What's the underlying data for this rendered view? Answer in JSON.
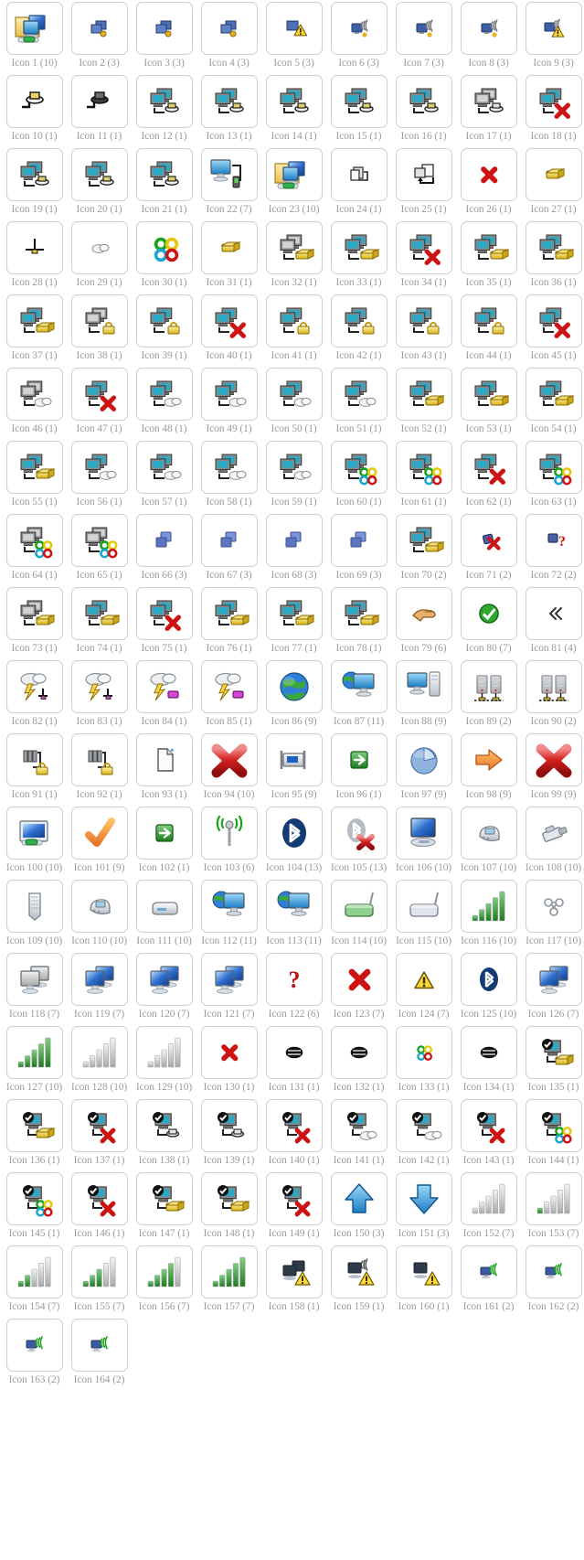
{
  "page": {
    "title": "Icon Sheet",
    "columns": 9,
    "total_icons": 164,
    "label_color": "#9b9b9b",
    "tile_border_color": "#cfcfcf",
    "background_color": "#ffffff"
  },
  "icons": [
    {
      "label": "Icon 1 (10)",
      "name": "folder-computers-cable",
      "glyph": "folder-pc"
    },
    {
      "label": "Icon 2 (3)",
      "name": "network-small-dot",
      "glyph": "mini-screens-dot"
    },
    {
      "label": "Icon 3 (3)",
      "name": "network-small-dot",
      "glyph": "mini-screens-dot"
    },
    {
      "label": "Icon 4 (3)",
      "name": "network-small-dot",
      "glyph": "mini-screens-dot"
    },
    {
      "label": "Icon 5 (3)",
      "name": "network-small-warning",
      "glyph": "mini-screens-warn"
    },
    {
      "label": "Icon 6 (3)",
      "name": "wireless-signal-small",
      "glyph": "mini-wireless"
    },
    {
      "label": "Icon 7 (3)",
      "name": "wireless-signal-small",
      "glyph": "mini-wireless"
    },
    {
      "label": "Icon 8 (3)",
      "name": "wireless-signal-dot",
      "glyph": "mini-wireless"
    },
    {
      "label": "Icon 9 (3)",
      "name": "wireless-warning",
      "glyph": "mini-wireless-warn"
    },
    {
      "label": "Icon 10 (1)",
      "name": "plug-connector",
      "glyph": "plug"
    },
    {
      "label": "Icon 11 (1)",
      "name": "plug-connector-dark",
      "glyph": "plug-dark"
    },
    {
      "label": "Icon 12 (1)",
      "name": "computer-to-plug",
      "glyph": "pc-plug"
    },
    {
      "label": "Icon 13 (1)",
      "name": "computer-to-plug",
      "glyph": "pc-plug"
    },
    {
      "label": "Icon 14 (1)",
      "name": "computer-to-plug",
      "glyph": "pc-plug"
    },
    {
      "label": "Icon 15 (1)",
      "name": "computer-to-plug",
      "glyph": "pc-plug"
    },
    {
      "label": "Icon 16 (1)",
      "name": "computer-to-plug",
      "glyph": "pc-plug"
    },
    {
      "label": "Icon 17 (1)",
      "name": "computer-grey-to-plug",
      "glyph": "pc-plug-grey"
    },
    {
      "label": "Icon 18 (1)",
      "name": "computer-disconnected",
      "glyph": "pc-error"
    },
    {
      "label": "Icon 19 (1)",
      "name": "computer-to-plug",
      "glyph": "pc-plug"
    },
    {
      "label": "Icon 20 (1)",
      "name": "computer-to-plug",
      "glyph": "pc-plug"
    },
    {
      "label": "Icon 21 (1)",
      "name": "computer-to-plug",
      "glyph": "pc-plug"
    },
    {
      "label": "Icon 22 (7)",
      "name": "monitor-with-device",
      "glyph": "monitor-device"
    },
    {
      "label": "Icon 23 (10)",
      "name": "folder-computers-cable",
      "glyph": "folder-pc"
    },
    {
      "label": "Icon 24 (1)",
      "name": "copy-small",
      "glyph": "copy"
    },
    {
      "label": "Icon 25 (1)",
      "name": "copy-arrow",
      "glyph": "copy-arrow"
    },
    {
      "label": "Icon 26 (1)",
      "name": "red-x-small",
      "glyph": "x-red-small"
    },
    {
      "label": "Icon 27 (1)",
      "name": "gold-connector",
      "glyph": "gold"
    },
    {
      "label": "Icon 28 (1)",
      "name": "ground-symbol",
      "glyph": "ground"
    },
    {
      "label": "Icon 29 (1)",
      "name": "cloud-small",
      "glyph": "cloud-sm"
    },
    {
      "label": "Icon 30 (1)",
      "name": "colored-loops",
      "glyph": "loops"
    },
    {
      "label": "Icon 31 (1)",
      "name": "gold-connector",
      "glyph": "gold"
    },
    {
      "label": "Icon 32 (1)",
      "name": "computer-grey-gold",
      "glyph": "pc-gold-grey"
    },
    {
      "label": "Icon 33 (1)",
      "name": "computer-gold",
      "glyph": "pc-gold"
    },
    {
      "label": "Icon 34 (1)",
      "name": "computer-gold-error",
      "glyph": "pc-error"
    },
    {
      "label": "Icon 35 (1)",
      "name": "computer-gold",
      "glyph": "pc-gold"
    },
    {
      "label": "Icon 36 (1)",
      "name": "computer-gold",
      "glyph": "pc-gold"
    },
    {
      "label": "Icon 37 (1)",
      "name": "computer-gold",
      "glyph": "pc-gold"
    },
    {
      "label": "Icon 38 (1)",
      "name": "computer-grey-lock",
      "glyph": "pc-lock-grey"
    },
    {
      "label": "Icon 39 (1)",
      "name": "computer-lock",
      "glyph": "pc-lock"
    },
    {
      "label": "Icon 40 (1)",
      "name": "computer-lock-error",
      "glyph": "pc-error"
    },
    {
      "label": "Icon 41 (1)",
      "name": "computer-lock",
      "glyph": "pc-lock"
    },
    {
      "label": "Icon 42 (1)",
      "name": "computer-lock",
      "glyph": "pc-lock"
    },
    {
      "label": "Icon 43 (1)",
      "name": "computer-lock",
      "glyph": "pc-lock"
    },
    {
      "label": "Icon 44 (1)",
      "name": "computer-lock",
      "glyph": "pc-lock"
    },
    {
      "label": "Icon 45 (1)",
      "name": "computer-lock-error",
      "glyph": "pc-error"
    },
    {
      "label": "Icon 46 (1)",
      "name": "computer-grey-cloud",
      "glyph": "pc-cloud-grey"
    },
    {
      "label": "Icon 47 (1)",
      "name": "computer-cloud-error",
      "glyph": "pc-error"
    },
    {
      "label": "Icon 48 (1)",
      "name": "computer-cloud",
      "glyph": "pc-cloud"
    },
    {
      "label": "Icon 49 (1)",
      "name": "computer-cloud",
      "glyph": "pc-cloud"
    },
    {
      "label": "Icon 50 (1)",
      "name": "computer-cloud",
      "glyph": "pc-cloud"
    },
    {
      "label": "Icon 51 (1)",
      "name": "computer-cloud",
      "glyph": "pc-cloud"
    },
    {
      "label": "Icon 52 (1)",
      "name": "computer-gold-up",
      "glyph": "pc-gold"
    },
    {
      "label": "Icon 53 (1)",
      "name": "computer-gold-up",
      "glyph": "pc-gold"
    },
    {
      "label": "Icon 54 (1)",
      "name": "computer-gold-up",
      "glyph": "pc-gold"
    },
    {
      "label": "Icon 55 (1)",
      "name": "computer-gold-up",
      "glyph": "pc-gold"
    },
    {
      "label": "Icon 56 (1)",
      "name": "computer-cloud-up",
      "glyph": "pc-cloud"
    },
    {
      "label": "Icon 57 (1)",
      "name": "computer-cloud-up",
      "glyph": "pc-cloud"
    },
    {
      "label": "Icon 58 (1)",
      "name": "computer-cloud-up",
      "glyph": "pc-cloud"
    },
    {
      "label": "Icon 59 (1)",
      "name": "computer-cloud-up",
      "glyph": "pc-cloud"
    },
    {
      "label": "Icon 60 (1)",
      "name": "computer-loops",
      "glyph": "pc-loops"
    },
    {
      "label": "Icon 61 (1)",
      "name": "computer-loops",
      "glyph": "pc-loops"
    },
    {
      "label": "Icon 62 (1)",
      "name": "computer-loops-error",
      "glyph": "pc-error"
    },
    {
      "label": "Icon 63 (1)",
      "name": "computer-loops",
      "glyph": "pc-loops"
    },
    {
      "label": "Icon 64 (1)",
      "name": "computer-grey-loops",
      "glyph": "pc-loops-grey"
    },
    {
      "label": "Icon 65 (1)",
      "name": "computer-grey-loops",
      "glyph": "pc-loops-grey"
    },
    {
      "label": "Icon 66 (3)",
      "name": "network-blue-small",
      "glyph": "mini-screens-blue"
    },
    {
      "label": "Icon 67 (3)",
      "name": "network-blue-small",
      "glyph": "mini-screens-blue"
    },
    {
      "label": "Icon 68 (3)",
      "name": "network-blue-small",
      "glyph": "mini-screens-blue"
    },
    {
      "label": "Icon 69 (3)",
      "name": "network-blue-small",
      "glyph": "mini-screens-blue"
    },
    {
      "label": "Icon 70 (2)",
      "name": "computer-gold-wave",
      "glyph": "pc-gold"
    },
    {
      "label": "Icon 71 (2)",
      "name": "network-red-x",
      "glyph": "net-x"
    },
    {
      "label": "Icon 72 (2)",
      "name": "network-question",
      "glyph": "net-question"
    },
    {
      "label": "Icon 73 (1)",
      "name": "computer-grey-gold",
      "glyph": "pc-gold-grey"
    },
    {
      "label": "Icon 74 (1)",
      "name": "computer-gold",
      "glyph": "pc-gold"
    },
    {
      "label": "Icon 75 (1)",
      "name": "computer-gold-error",
      "glyph": "pc-error"
    },
    {
      "label": "Icon 76 (1)",
      "name": "computer-gold",
      "glyph": "pc-gold"
    },
    {
      "label": "Icon 77 (1)",
      "name": "computer-gold",
      "glyph": "pc-gold"
    },
    {
      "label": "Icon 78 (1)",
      "name": "computer-gold",
      "glyph": "pc-gold"
    },
    {
      "label": "Icon 79 (6)",
      "name": "pointing-hand",
      "glyph": "hand"
    },
    {
      "label": "Icon 80 (7)",
      "name": "green-check-shield",
      "glyph": "check-green"
    },
    {
      "label": "Icon 81 (4)",
      "name": "double-chevron-left",
      "glyph": "chevrons"
    },
    {
      "label": "Icon 82 (1)",
      "name": "storm-cloud-ground",
      "glyph": "storm-ground"
    },
    {
      "label": "Icon 83 (1)",
      "name": "storm-cloud-ground",
      "glyph": "storm-ground"
    },
    {
      "label": "Icon 84 (1)",
      "name": "storm-cloud-device",
      "glyph": "storm-device"
    },
    {
      "label": "Icon 85 (1)",
      "name": "storm-cloud-device",
      "glyph": "storm-device"
    },
    {
      "label": "Icon 86 (9)",
      "name": "globe",
      "glyph": "globe"
    },
    {
      "label": "Icon 87 (11)",
      "name": "globe-monitor",
      "glyph": "globe-monitor"
    },
    {
      "label": "Icon 88 (9)",
      "name": "desktop-tower",
      "glyph": "desktop-tower"
    },
    {
      "label": "Icon 89 (2)",
      "name": "server-pair",
      "glyph": "servers"
    },
    {
      "label": "Icon 90 (2)",
      "name": "server-pair",
      "glyph": "servers"
    },
    {
      "label": "Icon 91 (1)",
      "name": "ports-to-plug",
      "glyph": "ports-plug"
    },
    {
      "label": "Icon 92 (1)",
      "name": "ports-to-plug",
      "glyph": "ports-plug"
    },
    {
      "label": "Icon 93 (1)",
      "name": "page-new",
      "glyph": "page"
    },
    {
      "label": "Icon 94 (10)",
      "name": "red-x-large",
      "glyph": "x-red-big"
    },
    {
      "label": "Icon 95 (9)",
      "name": "network-adapter",
      "glyph": "adapter"
    },
    {
      "label": "Icon 96 (1)",
      "name": "green-arrow-box",
      "glyph": "arrow-green-box"
    },
    {
      "label": "Icon 97 (9)",
      "name": "pie-chart",
      "glyph": "pie"
    },
    {
      "label": "Icon 98 (9)",
      "name": "orange-arrow-right",
      "glyph": "arrow-orange"
    },
    {
      "label": "Icon 99 (9)",
      "name": "red-x-large",
      "glyph": "x-red-big"
    },
    {
      "label": "Icon 100 (10)",
      "name": "monitor-cable",
      "glyph": "monitor-cable"
    },
    {
      "label": "Icon 101 (9)",
      "name": "orange-checkmark",
      "glyph": "check-orange"
    },
    {
      "label": "Icon 102 (1)",
      "name": "green-arrow-box",
      "glyph": "arrow-green-box"
    },
    {
      "label": "Icon 103 (6)",
      "name": "wireless-antenna",
      "glyph": "antenna"
    },
    {
      "label": "Icon 104 (13)",
      "name": "bluetooth-logo",
      "glyph": "bluetooth"
    },
    {
      "label": "Icon 105 (13)",
      "name": "bluetooth-disabled",
      "glyph": "bluetooth-off"
    },
    {
      "label": "Icon 106 (10)",
      "name": "monitor-dock",
      "glyph": "monitor-dock"
    },
    {
      "label": "Icon 107 (10)",
      "name": "modem-device",
      "glyph": "modem"
    },
    {
      "label": "Icon 108 (10)",
      "name": "rj45-connector",
      "glyph": "rj45"
    },
    {
      "label": "Icon 109 (10)",
      "name": "server-rack",
      "glyph": "server-tall"
    },
    {
      "label": "Icon 110 (10)",
      "name": "modem-device",
      "glyph": "modem"
    },
    {
      "label": "Icon 111 (10)",
      "name": "external-drive",
      "glyph": "ext-drive"
    },
    {
      "label": "Icon 112 (11)",
      "name": "globe-monitor",
      "glyph": "globe-monitor"
    },
    {
      "label": "Icon 113 (11)",
      "name": "globe-monitor",
      "glyph": "globe-monitor"
    },
    {
      "label": "Icon 114 (10)",
      "name": "router-green",
      "glyph": "router-green"
    },
    {
      "label": "Icon 115 (10)",
      "name": "router-grey",
      "glyph": "router-grey"
    },
    {
      "label": "Icon 116 (10)",
      "name": "signal-bars-green",
      "glyph": "bars-green"
    },
    {
      "label": "Icon 117 (10)",
      "name": "network-nodes",
      "glyph": "nodes"
    },
    {
      "label": "Icon 118 (7)",
      "name": "monitors-grey",
      "glyph": "monitors-grey"
    },
    {
      "label": "Icon 119 (7)",
      "name": "monitors-blue",
      "glyph": "monitors-blue"
    },
    {
      "label": "Icon 120 (7)",
      "name": "monitors-blue",
      "glyph": "monitors-blue"
    },
    {
      "label": "Icon 121 (7)",
      "name": "monitors-blue",
      "glyph": "monitors-blue"
    },
    {
      "label": "Icon 122 (6)",
      "name": "red-question-mark",
      "glyph": "question-red"
    },
    {
      "label": "Icon 123 (7)",
      "name": "red-x-medium",
      "glyph": "x-red-med"
    },
    {
      "label": "Icon 124 (7)",
      "name": "warning-triangle",
      "glyph": "warning"
    },
    {
      "label": "Icon 125 (10)",
      "name": "bluetooth-badge",
      "glyph": "bluetooth-badge"
    },
    {
      "label": "Icon 126 (7)",
      "name": "monitors-blue",
      "glyph": "monitors-blue"
    },
    {
      "label": "Icon 127 (10)",
      "name": "signal-bars-green",
      "glyph": "bars-green"
    },
    {
      "label": "Icon 128 (10)",
      "name": "signal-bars-grey",
      "glyph": "bars-grey"
    },
    {
      "label": "Icon 129 (10)",
      "name": "signal-bars-grey",
      "glyph": "bars-grey"
    },
    {
      "label": "Icon 130 (1)",
      "name": "red-x-small",
      "glyph": "x-red-small"
    },
    {
      "label": "Icon 131 (1)",
      "name": "black-disc",
      "glyph": "disc"
    },
    {
      "label": "Icon 132 (1)",
      "name": "black-disc",
      "glyph": "disc"
    },
    {
      "label": "Icon 133 (1)",
      "name": "colored-loops-small",
      "glyph": "loops-sm"
    },
    {
      "label": "Icon 134 (1)",
      "name": "black-disc",
      "glyph": "disc"
    },
    {
      "label": "Icon 135 (1)",
      "name": "checked-computer-gold",
      "glyph": "pc-check-gold"
    },
    {
      "label": "Icon 136 (1)",
      "name": "checked-computer-gold",
      "glyph": "pc-check-gold"
    },
    {
      "label": "Icon 137 (1)",
      "name": "checked-computer-error",
      "glyph": "pc-check-error"
    },
    {
      "label": "Icon 138 (1)",
      "name": "checked-computer-plug",
      "glyph": "pc-check-plug"
    },
    {
      "label": "Icon 139 (1)",
      "name": "checked-computer-plug",
      "glyph": "pc-check-plug"
    },
    {
      "label": "Icon 140 (1)",
      "name": "checked-computer-error",
      "glyph": "pc-check-error"
    },
    {
      "label": "Icon 141 (1)",
      "name": "checked-computer-cloud",
      "glyph": "pc-check-cloud"
    },
    {
      "label": "Icon 142 (1)",
      "name": "checked-computer-cloud",
      "glyph": "pc-check-cloud"
    },
    {
      "label": "Icon 143 (1)",
      "name": "checked-computer-error",
      "glyph": "pc-check-error"
    },
    {
      "label": "Icon 144 (1)",
      "name": "checked-computer-loops",
      "glyph": "pc-check-loops"
    },
    {
      "label": "Icon 145 (1)",
      "name": "checked-computer-loops",
      "glyph": "pc-check-loops"
    },
    {
      "label": "Icon 146 (1)",
      "name": "checked-computer-error",
      "glyph": "pc-check-error"
    },
    {
      "label": "Icon 147 (1)",
      "name": "checked-computer-gold",
      "glyph": "pc-check-gold"
    },
    {
      "label": "Icon 148 (1)",
      "name": "checked-computer-gold",
      "glyph": "pc-check-gold"
    },
    {
      "label": "Icon 149 (1)",
      "name": "checked-computer-error",
      "glyph": "pc-check-error"
    },
    {
      "label": "Icon 150 (3)",
      "name": "blue-arrow-up",
      "glyph": "arrow-up"
    },
    {
      "label": "Icon 151 (3)",
      "name": "blue-arrow-down",
      "glyph": "arrow-down"
    },
    {
      "label": "Icon 152 (7)",
      "name": "signal-bars-empty",
      "glyph": "bars-0"
    },
    {
      "label": "Icon 153 (7)",
      "name": "signal-bars-one",
      "glyph": "bars-1"
    },
    {
      "label": "Icon 154 (7)",
      "name": "signal-bars-two",
      "glyph": "bars-2"
    },
    {
      "label": "Icon 155 (7)",
      "name": "signal-bars-three",
      "glyph": "bars-3"
    },
    {
      "label": "Icon 156 (7)",
      "name": "signal-bars-four",
      "glyph": "bars-4"
    },
    {
      "label": "Icon 157 (7)",
      "name": "signal-bars-full",
      "glyph": "bars-5"
    },
    {
      "label": "Icon 158 (1)",
      "name": "monitors-warning",
      "glyph": "monitors-warn"
    },
    {
      "label": "Icon 159 (1)",
      "name": "monitor-wireless-warning",
      "glyph": "monitor-wifi-warn"
    },
    {
      "label": "Icon 160 (1)",
      "name": "monitor-warning",
      "glyph": "monitor-warn"
    },
    {
      "label": "Icon 161 (2)",
      "name": "monitor-wireless-small",
      "glyph": "mini-monitor-wifi"
    },
    {
      "label": "Icon 162 (2)",
      "name": "monitor-wireless-small",
      "glyph": "mini-monitor-wifi"
    },
    {
      "label": "Icon 163 (2)",
      "name": "monitor-wireless-small",
      "glyph": "mini-monitor-wifi"
    },
    {
      "label": "Icon 164 (2)",
      "name": "monitor-wireless-small",
      "glyph": "mini-monitor-wifi"
    }
  ]
}
